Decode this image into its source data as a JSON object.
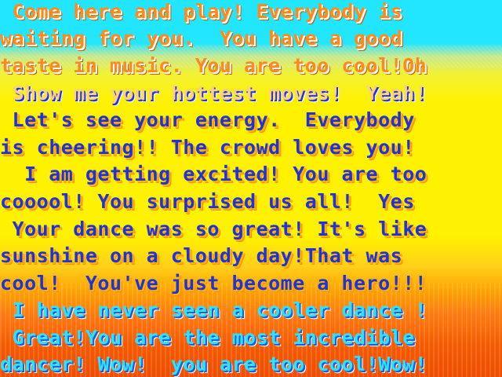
{
  "messages": [
    " Come here and play! Everybody is",
    "waiting for you.  You have a good",
    "taste in music. You are too cool!Oh",
    " Show me your hottest moves!  Yeah!",
    " Let's see your energy.  Everybody",
    "is cheering!! The crowd loves you!",
    "  I am getting excited! You are too",
    "cooool! You surprised us all!  Yes",
    " Your dance was so great! It's like",
    "sunshine on a cloudy day!That was",
    "cool!  You've just become a hero!!!",
    " I have never seen a cooler dance !",
    " Great!You are the most incredible",
    "dancer! Wow!  you are too cool!Wow!"
  ],
  "colors": {
    "sky": "#22e6ff",
    "yellow": "#fff200",
    "orange": "#f45a00",
    "text_orange": "#ff8a1a",
    "text_blue": "#1e34d6",
    "text_cyan": "#2fe0ff"
  }
}
